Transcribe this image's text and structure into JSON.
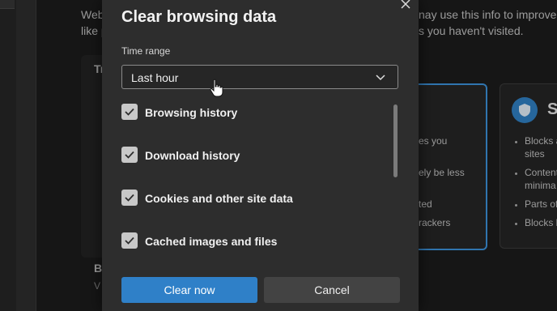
{
  "background": {
    "intro_left": "Web",
    "intro_left2": "like p",
    "intro_right1": "nay use this info to improve s",
    "intro_right2": "s you haven't visited.",
    "section_tr": "Tr",
    "section_bl": "Bl",
    "section_bl_sub": "V",
    "balanced_lines": [
      "es you",
      "ely be less",
      "ted",
      "rackers"
    ],
    "strict_title": "St",
    "strict_lines": [
      "Blocks a",
      "sites",
      "Content",
      "minima",
      "Parts of",
      "Blocks k"
    ],
    "accent_color": "#2f80c8"
  },
  "dialog": {
    "title": "Clear browsing data",
    "time_range_label": "Time range",
    "time_range_value": "Last hour",
    "items": [
      {
        "label": "Browsing history",
        "checked": true
      },
      {
        "label": "Download history",
        "checked": true
      },
      {
        "label": "Cookies and other site data",
        "checked": true
      },
      {
        "label": "Cached images and files",
        "checked": true
      }
    ],
    "clear_label": "Clear now",
    "cancel_label": "Cancel"
  }
}
